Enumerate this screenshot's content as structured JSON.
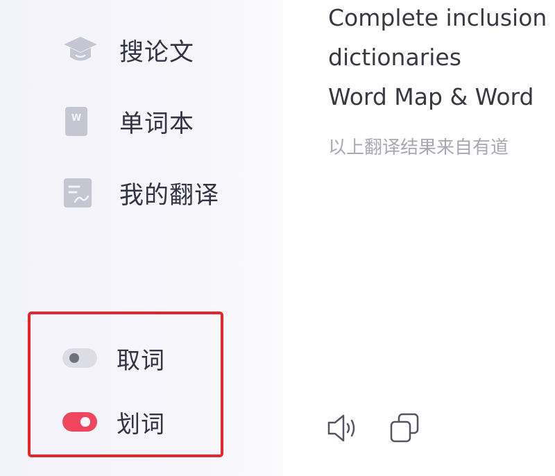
{
  "sidebar": {
    "items": [
      {
        "label": "搜论文",
        "icon": "graduation-cap-icon"
      },
      {
        "label": "单词本",
        "icon": "wordbook-icon"
      },
      {
        "label": "我的翻译",
        "icon": "my-translation-icon"
      }
    ],
    "toggles": [
      {
        "label": "取词",
        "state": "off"
      },
      {
        "label": "划词",
        "state": "on"
      }
    ]
  },
  "translation": {
    "lines": [
      "Complete inclusion",
      "dictionaries",
      "Word Map & Word"
    ],
    "source_note": "以上翻译结果来自有道",
    "actions": [
      {
        "icon": "speaker-icon"
      },
      {
        "icon": "copy-icon"
      }
    ]
  },
  "colors": {
    "accent": "#f0475f",
    "highlight_border": "#e6262b",
    "icon_gray": "#c4c6d2"
  }
}
